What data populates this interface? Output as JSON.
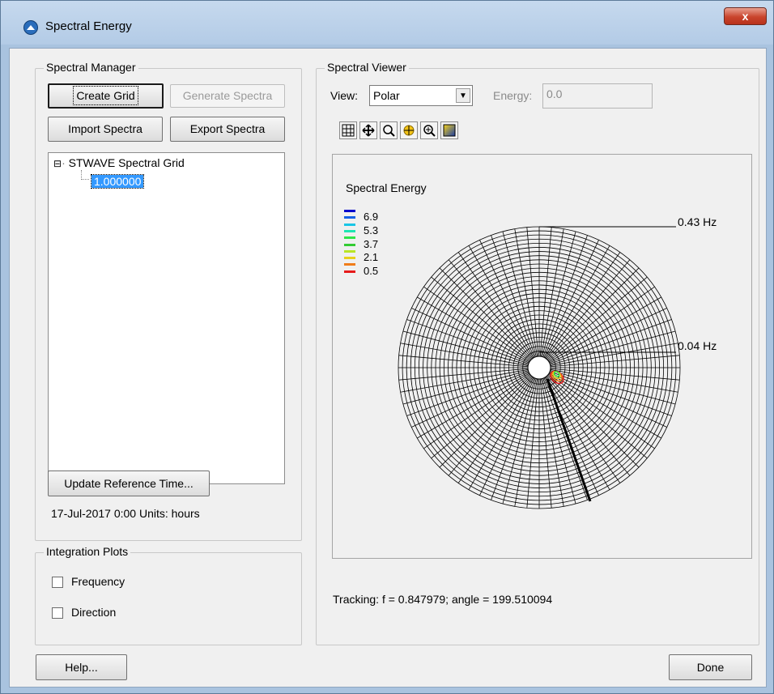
{
  "window": {
    "title": "Spectral Energy",
    "close_label": "x"
  },
  "manager": {
    "label": "Spectral Manager",
    "create_grid": "Create Grid",
    "generate_spectra": "Generate Spectra",
    "import_spectra": "Import Spectra",
    "export_spectra": "Export Spectra",
    "tree": {
      "root": "STWAVE Spectral Grid",
      "expander": "⊟",
      "child": "1.000000"
    },
    "update_reference": "Update Reference Time...",
    "reference_info": "17-Jul-2017 0:00 Units: hours"
  },
  "integration": {
    "label": "Integration Plots",
    "frequency": "Frequency",
    "direction": "Direction"
  },
  "viewer": {
    "label": "Spectral Viewer",
    "view_label": "View:",
    "view_value": "Polar",
    "energy_label": "Energy:",
    "energy_value": "0.0",
    "tools": [
      "grid-select-icon",
      "pan-icon",
      "zoom-icon",
      "frame-icon",
      "zoom-extent-icon",
      "color-ramp-icon"
    ],
    "tracking": "Tracking: f = 0.847979; angle = 199.510094"
  },
  "chart_data": {
    "type": "polar",
    "title": "Spectral Energy",
    "legend": [
      {
        "value": "",
        "color": "#0000cc"
      },
      {
        "value": "6.9",
        "color": "#1560e6"
      },
      {
        "value": "",
        "color": "#19c6e6"
      },
      {
        "value": "5.3",
        "color": "#1ee6b4"
      },
      {
        "value": "",
        "color": "#2ee64a"
      },
      {
        "value": "3.7",
        "color": "#33cc33"
      },
      {
        "value": "",
        "color": "#b8e626"
      },
      {
        "value": "2.1",
        "color": "#e6d21a"
      },
      {
        "value": "",
        "color": "#f07d1a"
      },
      {
        "value": "0.5",
        "color": "#e61a1a"
      }
    ],
    "ring_labels": [
      "0.43 Hz",
      "0.04 Hz"
    ]
  },
  "footer": {
    "help": "Help...",
    "done": "Done"
  }
}
